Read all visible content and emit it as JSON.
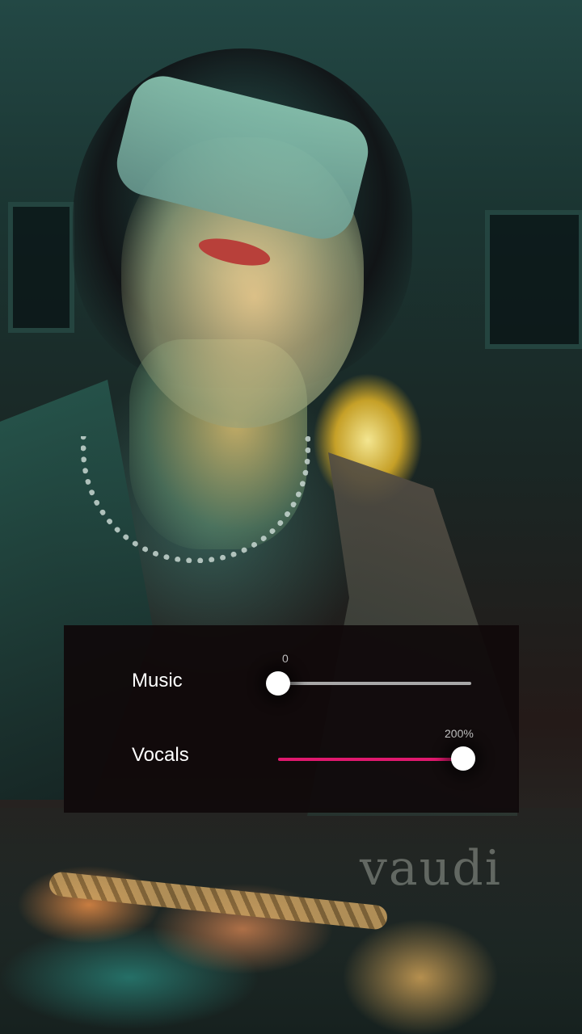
{
  "watermark": "vaudi",
  "mixer": {
    "music": {
      "label": "Music",
      "value_label": "0",
      "level_fraction": 0.0
    },
    "vocals": {
      "label": "Vocals",
      "value_label": "200%",
      "level_fraction": 1.0
    }
  },
  "colors": {
    "vocals_track": "#e0196e",
    "music_track": "#a8a8a8",
    "panel_background": "#100a0b"
  }
}
